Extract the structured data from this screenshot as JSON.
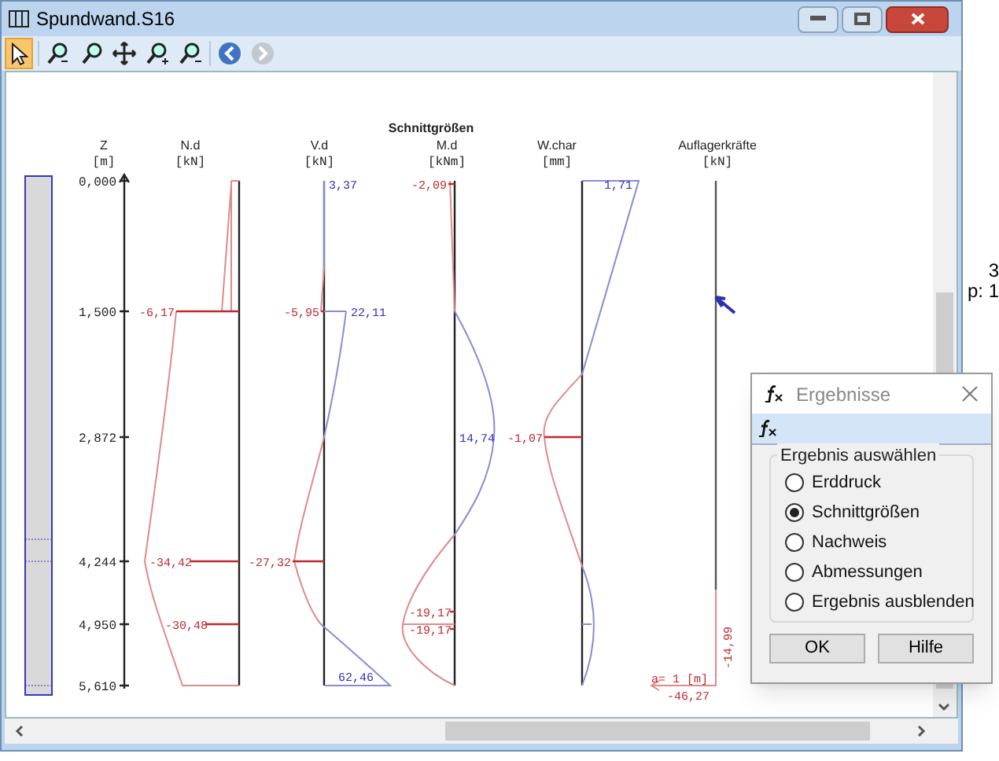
{
  "window": {
    "title": "Spundwand.S16"
  },
  "toolbar": [
    {
      "kind": "select",
      "selected": true,
      "disabled": false
    },
    {
      "kind": "zoom-window",
      "selected": false,
      "disabled": false
    },
    {
      "kind": "zoom",
      "selected": false,
      "disabled": false
    },
    {
      "kind": "pan",
      "selected": false,
      "disabled": false
    },
    {
      "kind": "zoom-in",
      "selected": false,
      "disabled": false
    },
    {
      "kind": "zoom-out",
      "selected": false,
      "disabled": false
    },
    {
      "kind": "back",
      "selected": false,
      "disabled": false
    },
    {
      "kind": "forward",
      "selected": false,
      "disabled": true
    }
  ],
  "diagram": {
    "title": "Schnittgrößen",
    "depth": {
      "header": "Z",
      "unit": "[m]",
      "values": [
        "0,000",
        "1,500",
        "2,872",
        "4,244",
        "4,950",
        "5,610"
      ]
    },
    "columns": [
      {
        "header": "N.d",
        "unit": "[kN]",
        "labels": [
          "-6,17",
          "-34,42",
          "-30,48"
        ]
      },
      {
        "header": "V.d",
        "unit": "[kN]",
        "labels": [
          "3,37",
          "-5,95",
          "22,11",
          "-27,32",
          "62,46"
        ]
      },
      {
        "header": "M.d",
        "unit": "[kNm]",
        "labels": [
          "-2,09",
          "14,74",
          "-19,17",
          "-19,17"
        ]
      },
      {
        "header": "W.char",
        "unit": "[mm]",
        "labels": [
          "1,71",
          "-1,07"
        ]
      },
      {
        "header": "Auflagerkräfte",
        "unit": "[kN]",
        "labels": [
          "-14,99",
          "a= 1 [m]",
          "-46,27"
        ]
      }
    ]
  },
  "side_text": [
    "3",
    "p: 1"
  ],
  "dialog": {
    "title": "Ergebnisse",
    "group": "Ergebnis auswählen",
    "options": [
      {
        "label": "Erddruck",
        "selected": false
      },
      {
        "label": "Schnittgrößen",
        "selected": true
      },
      {
        "label": "Nachweis",
        "selected": false
      },
      {
        "label": "Abmessungen",
        "selected": false
      },
      {
        "label": "Ergebnis ausblenden",
        "selected": false
      }
    ],
    "buttons": [
      "OK",
      "Hilfe"
    ]
  }
}
